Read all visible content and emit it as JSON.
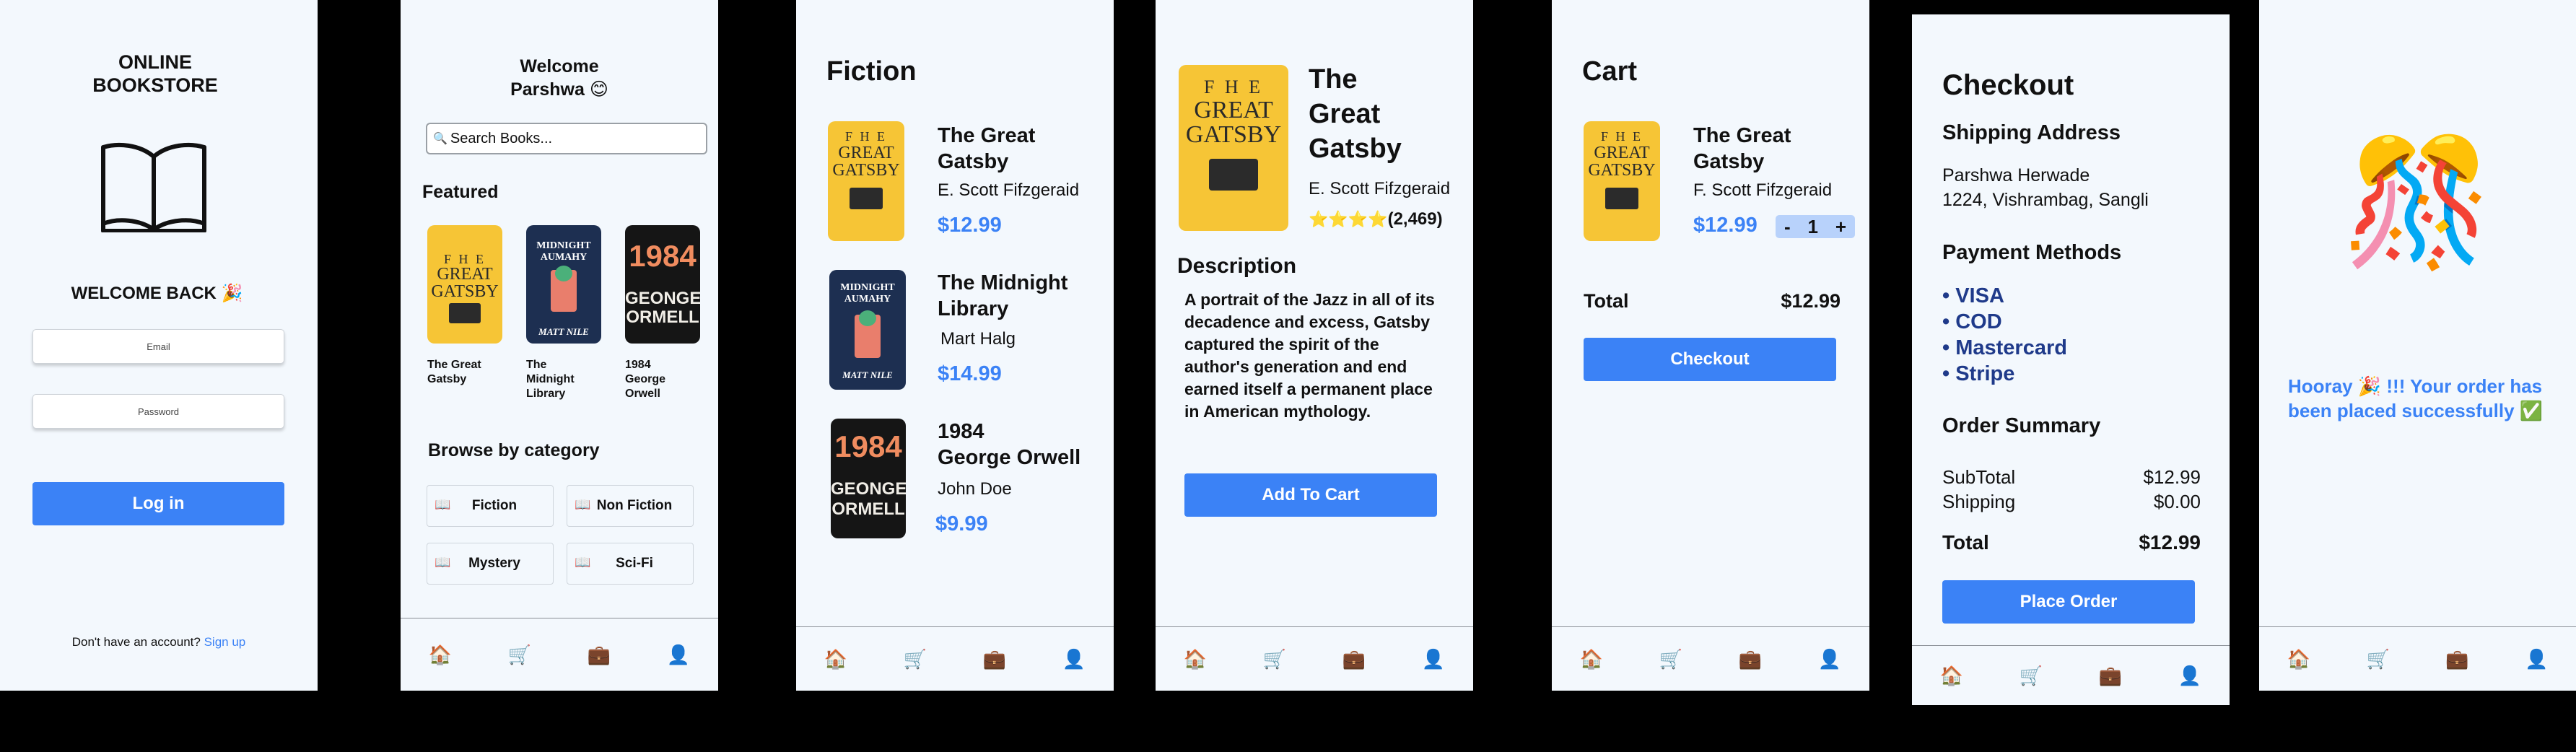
{
  "login": {
    "app_title_line1": "ONLINE",
    "app_title_line2": "BOOKSTORE",
    "welcome": "WELCOME BACK 🎉",
    "email_placeholder": "Email",
    "password_placeholder": "Password",
    "login_button": "Log in",
    "signup_prompt": "Don't have an account?",
    "signup_link": "Sign up"
  },
  "home": {
    "greeting_line1": "Welcome",
    "greeting_line2": "Parshwa 😊",
    "search_placeholder": "Search Books...",
    "featured_heading": "Featured",
    "featured": [
      {
        "line1": "The Great",
        "line2": "Gatsby",
        "line3": ""
      },
      {
        "line1": "The",
        "line2": "Midnight",
        "line3": "Library"
      },
      {
        "line1": "1984",
        "line2": "George",
        "line3": "Orwell"
      }
    ],
    "browse_heading": "Browse by category",
    "categories": [
      "Fiction",
      "Non Fiction",
      "Mystery",
      "Sci-Fi"
    ]
  },
  "fiction": {
    "title": "Fiction",
    "books": [
      {
        "title_line1": "The Great",
        "title_line2": "Gatsby",
        "author": "E. Scott Fifzgeraid",
        "price": "$12.99"
      },
      {
        "title_line1": "The Midnight",
        "title_line2": "Library",
        "author": "Mart Halg",
        "price": "$14.99"
      },
      {
        "title_line1": "1984",
        "title_line2": "George Orwell",
        "author": "John Doe",
        "price": "$9.99"
      }
    ]
  },
  "detail": {
    "title_line1": "The",
    "title_line2": "Great",
    "title_line3": "Gatsby",
    "author": "E. Scott Fifzgeraid",
    "stars": "⭐⭐⭐⭐",
    "rating_count": "(2,469)",
    "description_heading": "Description",
    "description": "A portrait of the Jazz in all of its decadence and excess, Gatsby captured the spirit of the author's generation and end earned itself a permanent place in American mythology.",
    "add_to_cart": "Add To Cart"
  },
  "cart": {
    "title": "Cart",
    "item_title_line1": "The Great",
    "item_title_line2": "Gatsby",
    "item_author": "F. Scott Fifzgeraid",
    "item_price": "$12.99",
    "qty_minus": "-",
    "qty": "1",
    "qty_plus": "+",
    "total_label": "Total",
    "total_value": "$12.99",
    "checkout_button": "Checkout"
  },
  "checkout": {
    "title": "Checkout",
    "shipping_heading": "Shipping Address",
    "address_line1": "Parshwa Herwade",
    "address_line2": "1224, Vishrambag, Sangli",
    "payment_heading": "Payment Methods",
    "payment_methods": [
      "VISA",
      "COD",
      "Mastercard",
      "Stripe"
    ],
    "summary_heading": "Order Summary",
    "subtotal_label": "SubTotal",
    "subtotal_value": "$12.99",
    "shipping_label": "Shipping",
    "shipping_value": "$0.00",
    "total_label": "Total",
    "total_value": "$12.99",
    "place_order": "Place Order"
  },
  "success": {
    "emoji": "🎊",
    "message_line1": "Hooray 🎉 !!! Your order has",
    "message_line2": "been placed successfully ✅"
  },
  "covers": {
    "gatsby_line1": "F H E",
    "gatsby_line2": "GREAT",
    "gatsby_line3": "GATSBY",
    "midnight_line1": "MIDNIGHT",
    "midnight_line2": "AUMAHY",
    "midnight_author": "MATT NILE",
    "orwell_num": "1984",
    "orwell_line1": "GEONGE",
    "orwell_line2": "ORMELL"
  },
  "nav": {
    "home_icon": "🏠",
    "cart_icon": "🛒",
    "orders_icon": "💼",
    "profile_icon": "👤"
  },
  "colors": {
    "accent": "#3b82f6",
    "background": "#f3f8fd",
    "gatsby_cover": "#f6c536",
    "midnight_cover": "#1d2f51",
    "orwell_cover": "#151515"
  }
}
